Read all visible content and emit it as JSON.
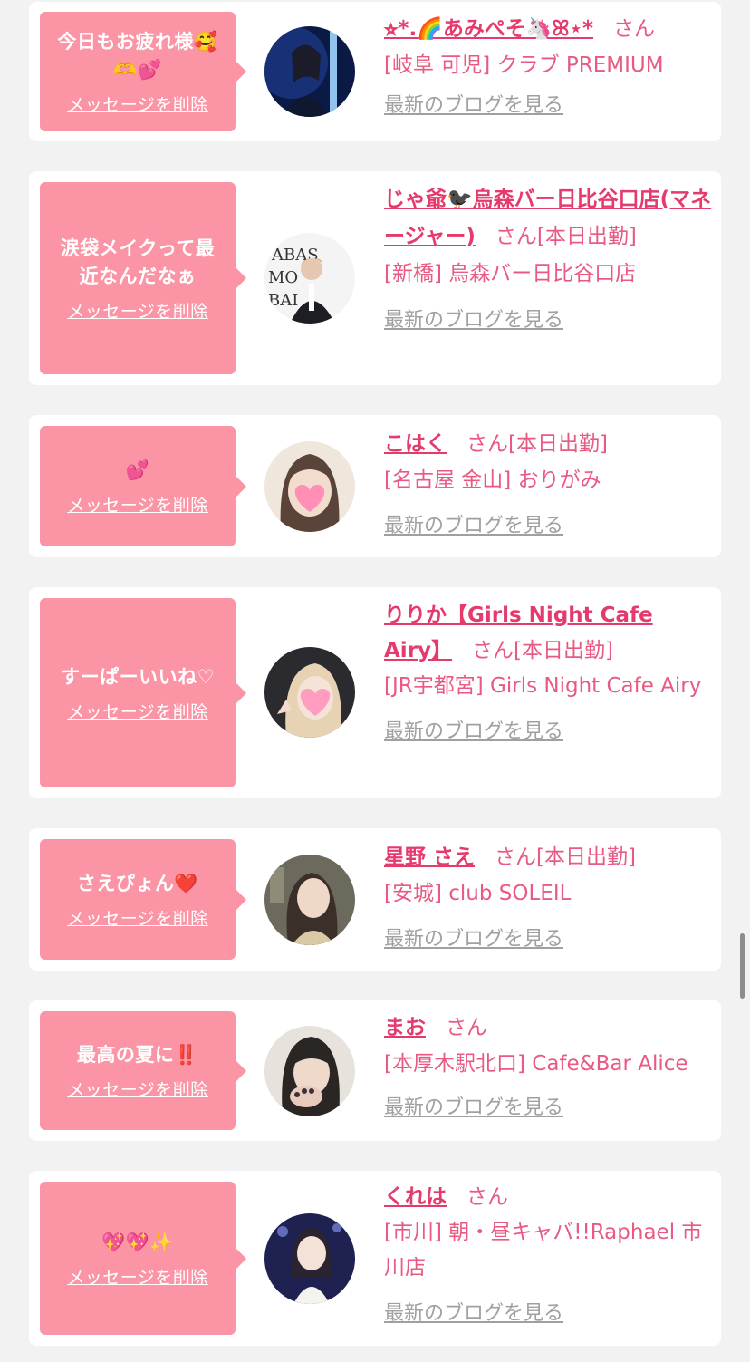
{
  "common": {
    "delete_label": "メッセージを削除",
    "blog_label": "最新のブログを見る",
    "san": "さん"
  },
  "colors": {
    "bubble": "#fb95a6",
    "name": "#e53a6c",
    "blog_link": "#a0a0a0",
    "background": "#f2f2f2"
  },
  "items": [
    {
      "message": "今日もお疲れ様🥰\n🫶💕",
      "name": "⭐︎*.🌈あみぺそ🦄ꕤ⋆*",
      "shift": "",
      "shop": "[岐阜 可児] クラブ PREMIUM",
      "avatar_icon": "avatar-photo"
    },
    {
      "message": "涙袋メイクって最\n近なんだなぁ",
      "name": "じゃ爺🐦‍⬛烏森バー日比谷口店(マネージャー)",
      "shift": "[本日出勤]",
      "shop": "[新橋] 烏森バー日比谷口店",
      "avatar_icon": "avatar-photo"
    },
    {
      "message": "💕",
      "name": "こはく",
      "shift": "[本日出勤]",
      "shop": "[名古屋 金山] おりがみ",
      "avatar_icon": "avatar-photo"
    },
    {
      "message": "すーぱーいいね♡",
      "name": "りりか【Girls Night Cafe Airy】",
      "shift": "[本日出勤]",
      "shop": "[JR宇都宮] Girls Night Cafe Airy",
      "avatar_icon": "avatar-photo"
    },
    {
      "message": "さえぴょん❤️",
      "name": "星野 さえ",
      "shift": "[本日出勤]",
      "shop": "[安城] club SOLEIL",
      "avatar_icon": "avatar-photo"
    },
    {
      "message": "最高の夏に‼️",
      "name": "まお",
      "shift": "",
      "shop": "[本厚木駅北口] Cafe&Bar Alice",
      "avatar_icon": "avatar-photo"
    },
    {
      "message": "💖💖✨",
      "name": "くれは",
      "shift": "",
      "shop": "[市川] 朝・昼キャバ!!Raphael 市川店",
      "avatar_icon": "avatar-photo"
    }
  ]
}
